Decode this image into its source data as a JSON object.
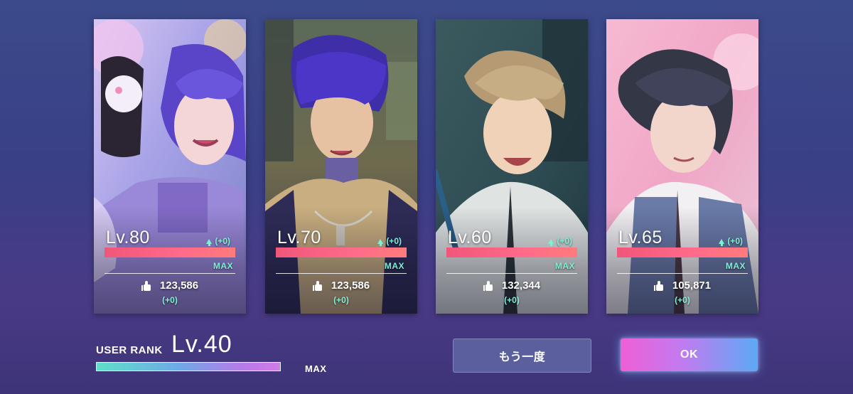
{
  "cards": [
    {
      "level": "Lv.80",
      "delta": "(+0)",
      "max": "MAX",
      "likes": "123,586",
      "likes_delta": "(+0)"
    },
    {
      "level": "Lv.70",
      "delta": "(+0)",
      "max": "MAX",
      "likes": "123,586",
      "likes_delta": "(+0)"
    },
    {
      "level": "Lv.60",
      "delta": "(+0)",
      "max": "MAX",
      "likes": "132,344",
      "likes_delta": "(+0)"
    },
    {
      "level": "Lv.65",
      "delta": "(+0)",
      "max": "MAX",
      "likes": "105,871",
      "likes_delta": "(+0)"
    }
  ],
  "user_rank": {
    "label": "USER RANK",
    "level": "Lv.40",
    "max": "MAX",
    "progress": 1.0
  },
  "buttons": {
    "retry": "もう一度",
    "ok": "OK"
  },
  "icons": {
    "delta": "arrow-up-icon",
    "likes": "thumbs-up-icon"
  },
  "colors": {
    "accent_teal": "#7ff0d4",
    "level_bar": "#ff6b8a",
    "ok_gradient_start": "#ef5fd6",
    "ok_gradient_end": "#5ca9f5",
    "retry_button": "#5c5f9d"
  }
}
